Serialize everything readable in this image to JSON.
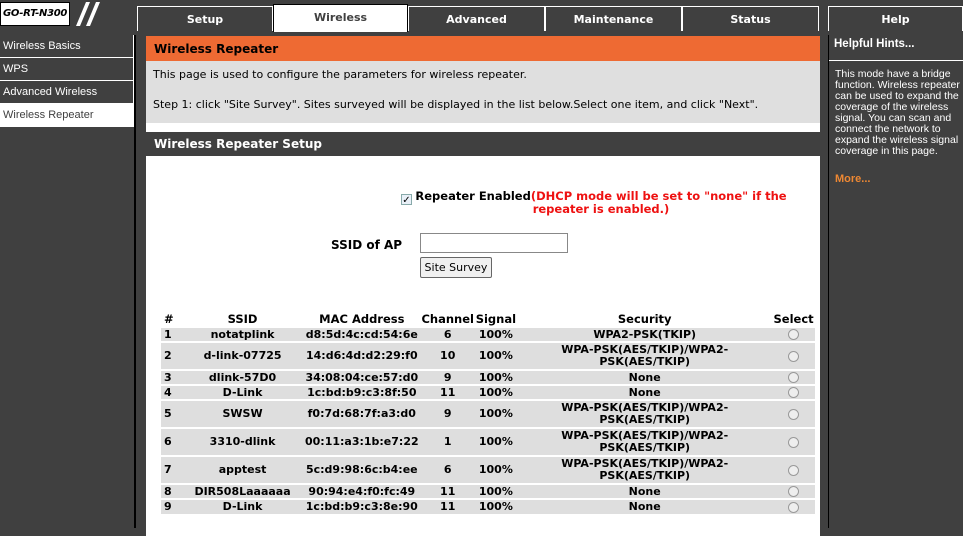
{
  "brand": "GO-RT-N300",
  "tabs": [
    "Setup",
    "Wireless",
    "Advanced",
    "Maintenance",
    "Status",
    "Help"
  ],
  "sidebar": [
    "Wireless Basics",
    "WPS",
    "Advanced Wireless",
    "Wireless Repeater"
  ],
  "section_title": "Wireless Repeater",
  "intro_line1": "This page is used to configure the parameters for wireless repeater.",
  "intro_line2": "Step 1: click \"Site Survey\". Sites surveyed will be displayed in the list below.Select one item, and click \"Next\".",
  "setup_title": "Wireless Repeater Setup",
  "repeater_label": "Repeater Enabled",
  "repeater_warning": "(DHCP mode will be set to \"none\" if the repeater is enabled.)",
  "repeater_checked": true,
  "ssid_label": "SSID of AP",
  "ssid_value": "",
  "survey_button": "Site Survey",
  "table_headers": [
    "#",
    "SSID",
    "MAC Address",
    "Channel",
    "Signal",
    "Security",
    "Select"
  ],
  "sites": [
    {
      "n": "1",
      "ssid": "notatplink",
      "mac": "d8:5d:4c:cd:54:6e",
      "ch": "6",
      "sig": "100%",
      "sec": "WPA2-PSK(TKIP)"
    },
    {
      "n": "2",
      "ssid": "d-link-07725",
      "mac": "14:d6:4d:d2:29:f0",
      "ch": "10",
      "sig": "100%",
      "sec": "WPA-PSK(AES/TKIP)/WPA2-PSK(AES/TKIP)"
    },
    {
      "n": "3",
      "ssid": "dlink-57D0",
      "mac": "34:08:04:ce:57:d0",
      "ch": "9",
      "sig": "100%",
      "sec": "None"
    },
    {
      "n": "4",
      "ssid": "D-Link",
      "mac": "1c:bd:b9:c3:8f:50",
      "ch": "11",
      "sig": "100%",
      "sec": "None"
    },
    {
      "n": "5",
      "ssid": "SWSW",
      "mac": "f0:7d:68:7f:a3:d0",
      "ch": "9",
      "sig": "100%",
      "sec": "WPA-PSK(AES/TKIP)/WPA2-PSK(AES/TKIP)"
    },
    {
      "n": "6",
      "ssid": "3310-dlink",
      "mac": "00:11:a3:1b:e7:22",
      "ch": "1",
      "sig": "100%",
      "sec": "WPA-PSK(AES/TKIP)/WPA2-PSK(AES/TKIP)"
    },
    {
      "n": "7",
      "ssid": "apptest",
      "mac": "5c:d9:98:6c:b4:ee",
      "ch": "6",
      "sig": "100%",
      "sec": "WPA-PSK(AES/TKIP)/WPA2-PSK(AES/TKIP)"
    },
    {
      "n": "8",
      "ssid": "DIR508Laaaaaa",
      "mac": "90:94:e4:f0:fc:49",
      "ch": "11",
      "sig": "100%",
      "sec": "None"
    },
    {
      "n": "9",
      "ssid": "D-Link",
      "mac": "1c:bd:b9:c3:8e:90",
      "ch": "11",
      "sig": "100%",
      "sec": "None"
    }
  ],
  "hints_title": "Helpful Hints...",
  "hints_body": "This mode have a bridge function. Wireless repeater can be used to expand the coverage of the wireless signal. You can scan and connect the network to expand the wireless signal coverage in this page.",
  "hints_more": "More..."
}
